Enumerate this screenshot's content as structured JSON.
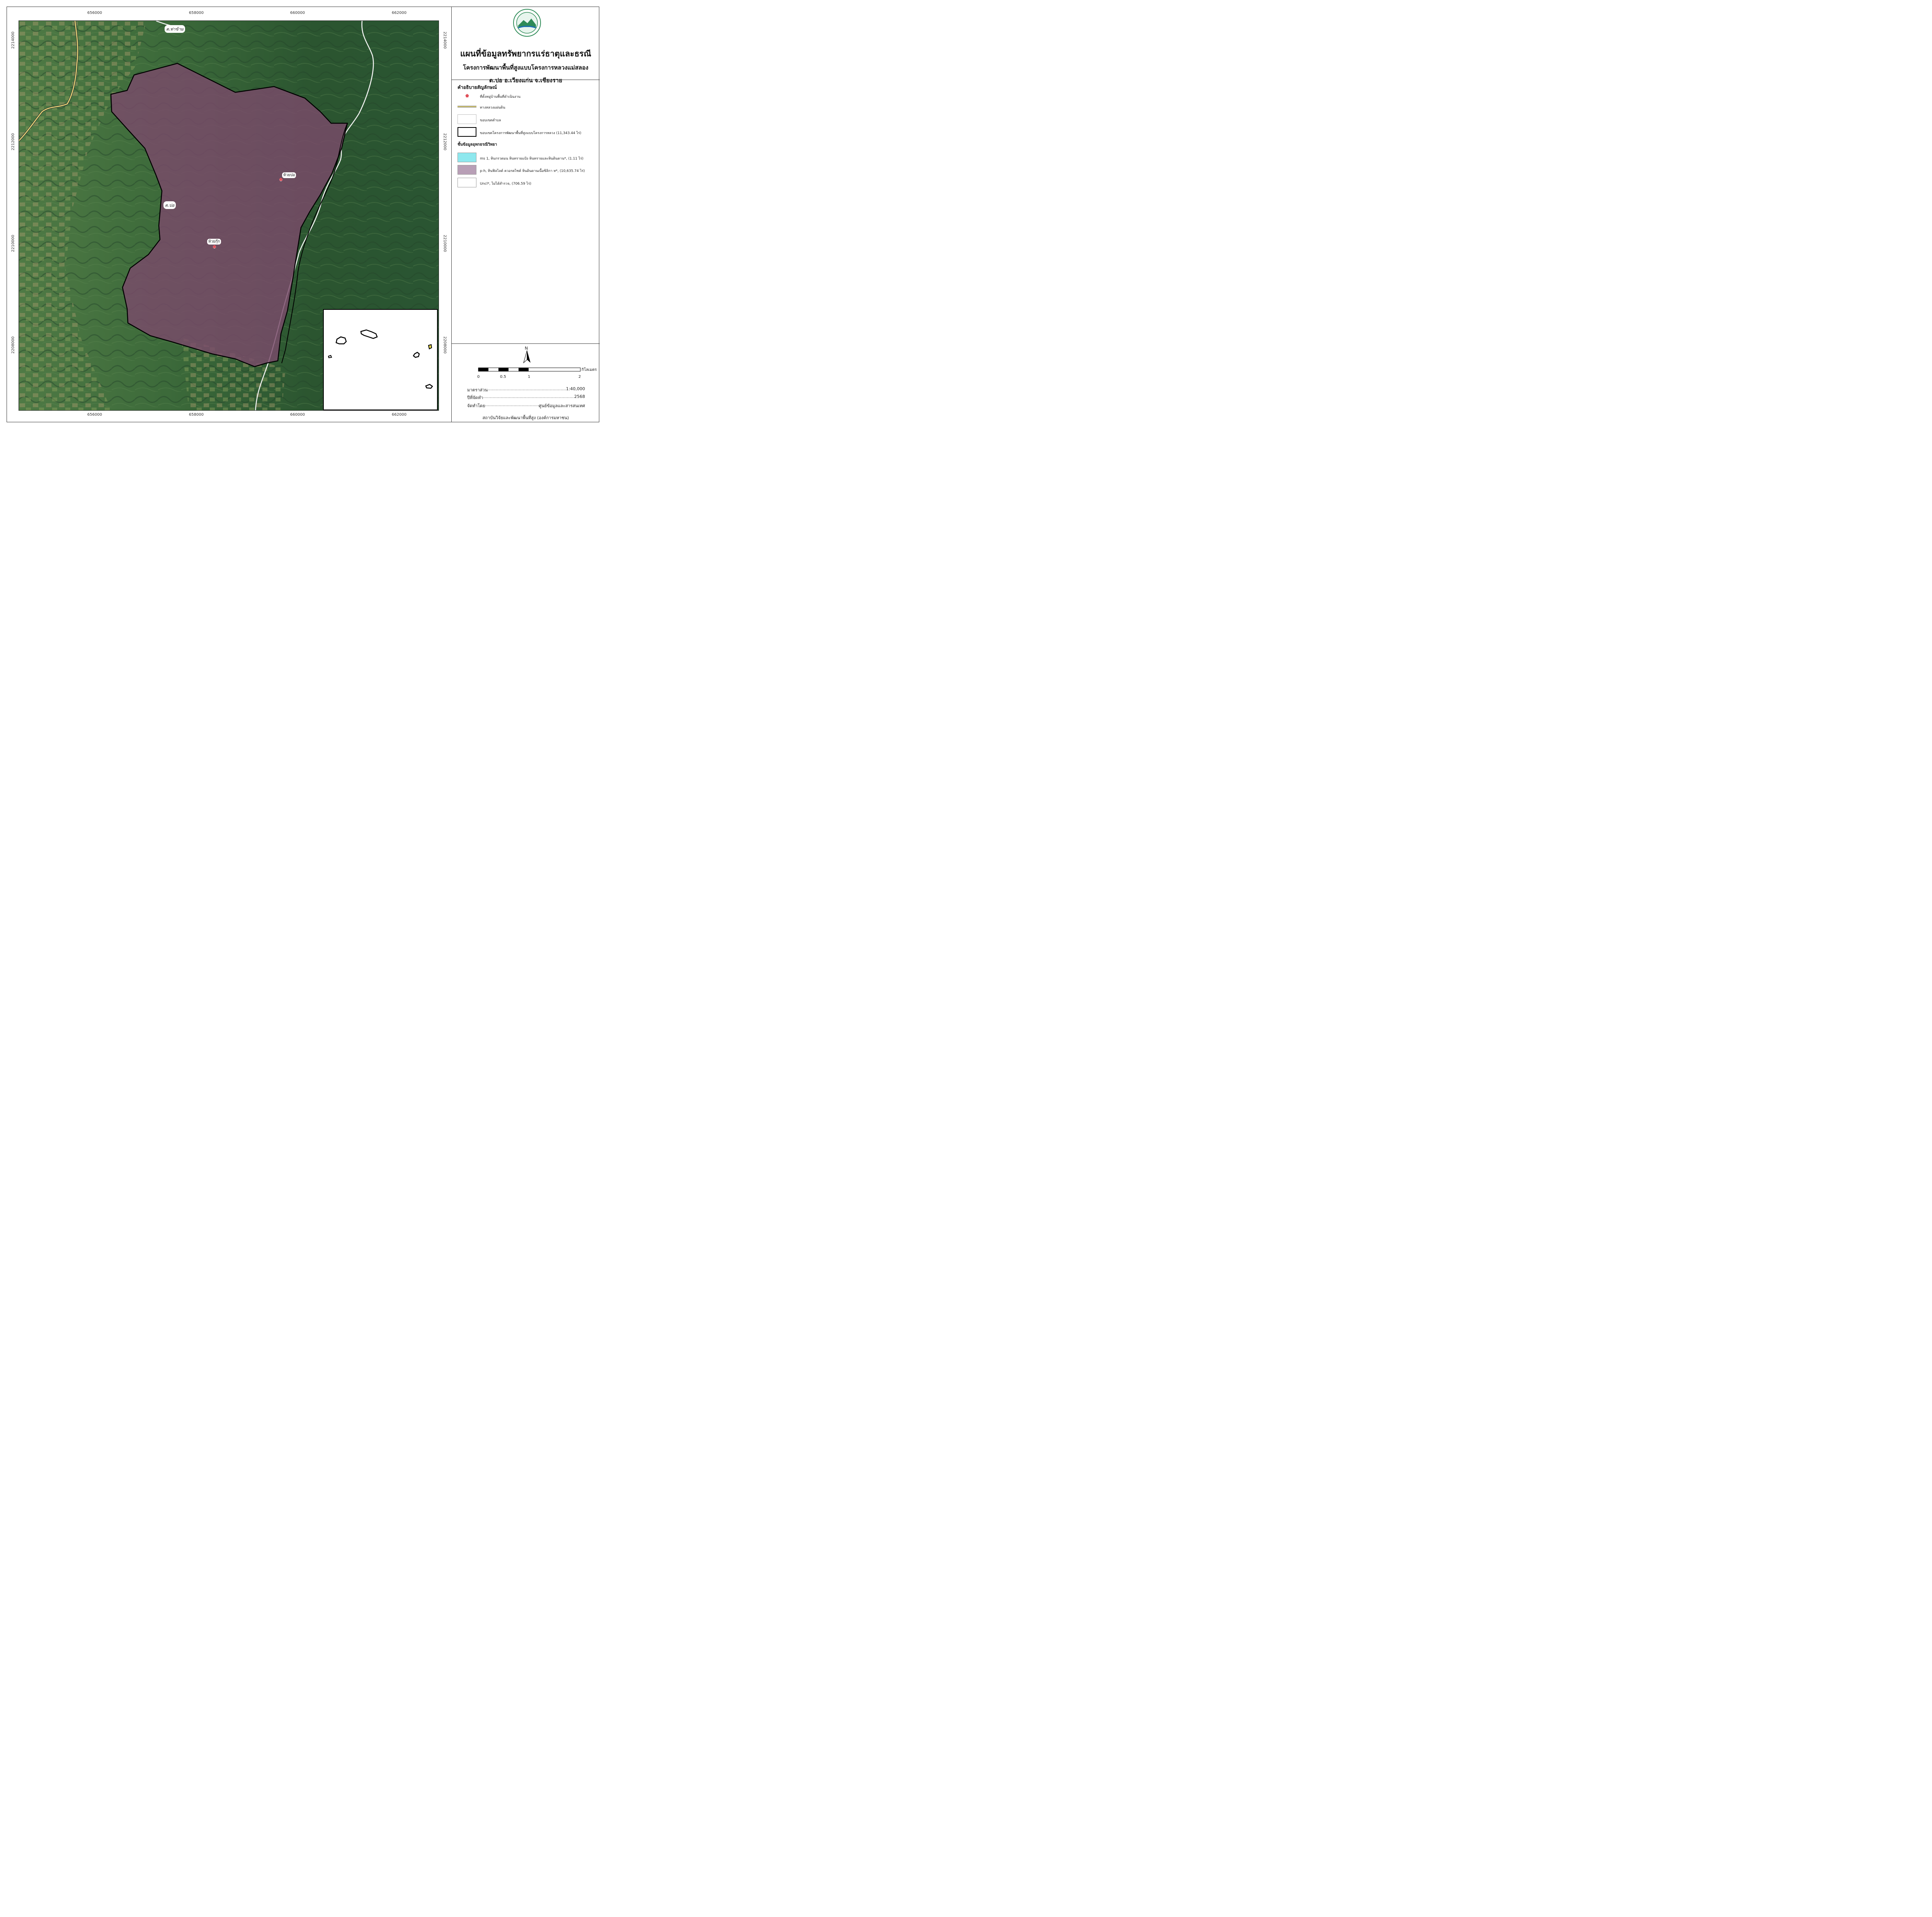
{
  "map": {
    "title": "แผนที่ข้อมูลทรัพยากรแร่ธาตุและธรณี",
    "subtitle": "โครงการพัฒนาพื้นที่สูงแบบโครงการหลวงแม่สลอง",
    "location": "ต.ปอ อ.เวียงแก่น จ.เชียงราย",
    "x_ticks": [
      "656000",
      "658000",
      "660000",
      "662000"
    ],
    "y_ticks": [
      "2214000",
      "2212000",
      "2210000",
      "2208000"
    ],
    "place_labels": {
      "tha_kham": "ต.ท่าข้าม",
      "po": "ต.ปอ"
    },
    "villages": {
      "huai_po": "ห้วยปอ",
      "huai_kuk": "ห้วยกุ๊ก"
    },
    "colors": {
      "project_area": "#7a4a6a",
      "forest": "#2f5a35",
      "road": "#f2e27a",
      "boundary": "#000000",
      "village_marker": "#e0505a"
    }
  },
  "legend": {
    "heading": "คำอธิบายสัญลักษณ์",
    "village_point": "ที่ตั้งหมู่บ้านพื้นที่ดำเนินงาน",
    "highway": "ทางหลวงแผ่นดิน",
    "subdistrict_boundary": "ขอบเขตตำบล",
    "project_boundary": "ขอบเขตโครงการพัฒนาพื้นที่สูงแบบโครงการหลวง (11,343.44 ไร่)",
    "geology_heading": "ชั้นข้อมูลอุทกธรณีวิทยา",
    "geology": [
      {
        "label": "ms 1, หินกรวดมน หินทรายแป้ง หินทรายและหินดินดาน*, (1.11 ไร่)",
        "color": "#8ee8ee"
      },
      {
        "label": "p-h, หินฟิลไลต์ ควอรตไซต์ หินดินดานเนื้อซิลิกา ห*, (10,635.74 ไร่)",
        "color": "#b89fb6"
      },
      {
        "label": "Uncl*, ไม่ได้สำรวจ, (706.59 ไร่)",
        "color": "#ffffff"
      }
    ]
  },
  "scale": {
    "north": "N",
    "unit": "กิโลเมตร",
    "labels": [
      "0",
      "0.5",
      "1",
      "2"
    ],
    "ratio_label": "มาตราส่วน",
    "ratio_value": "1:40,000",
    "year_label": "ปีที่จัดทำ",
    "year_value": "2568",
    "made_by_label": "จัดทำโดย",
    "made_by_value": "ศูนย์ข้อมูลและสารสนเทศ",
    "organization": "สถาบันวิจัยและพัฒนาพื้นที่สูง (องค์การมหาชน)",
    "dots": "......................................................................................................................"
  }
}
